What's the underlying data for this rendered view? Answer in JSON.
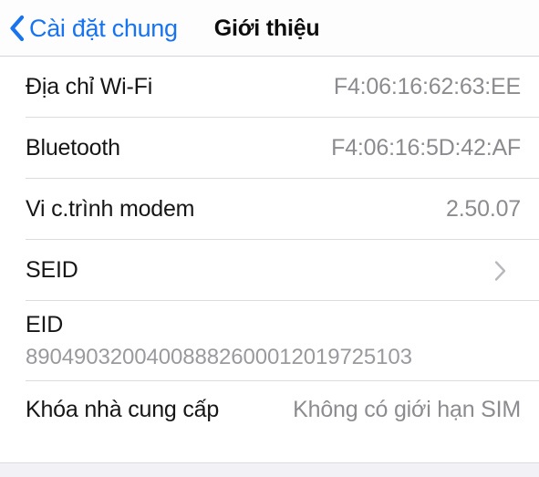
{
  "navbar": {
    "back_label": "Cài đặt chung",
    "back_icon": "chevron-left-icon",
    "title": "Giới thiệu",
    "accent_color": "#1773ee"
  },
  "colors": {
    "background": "#ffffff",
    "label_text": "#161616",
    "value_text": "#8c8c90",
    "separator": "#dcdcdf",
    "footer_strip": "#f1f1f6",
    "chevron_gray": "#b8b8bc"
  },
  "list": {
    "rows": [
      {
        "label": "Địa chỉ Wi-Fi",
        "value": "F4:06:16:62:63:EE",
        "type": "value"
      },
      {
        "label": "Bluetooth",
        "value": "F4:06:16:5D:42:AF",
        "type": "value"
      },
      {
        "label": "Vi c.trình modem",
        "value": "2.50.07",
        "type": "value"
      },
      {
        "label": "SEID",
        "value": "",
        "type": "disclosure",
        "icon": "chevron-right-icon"
      },
      {
        "label": "EID",
        "value": "89049032004008882600012019725103",
        "type": "stacked"
      },
      {
        "label": "Khóa nhà cung cấp",
        "value": "Không có giới hạn SIM",
        "type": "value"
      }
    ]
  }
}
